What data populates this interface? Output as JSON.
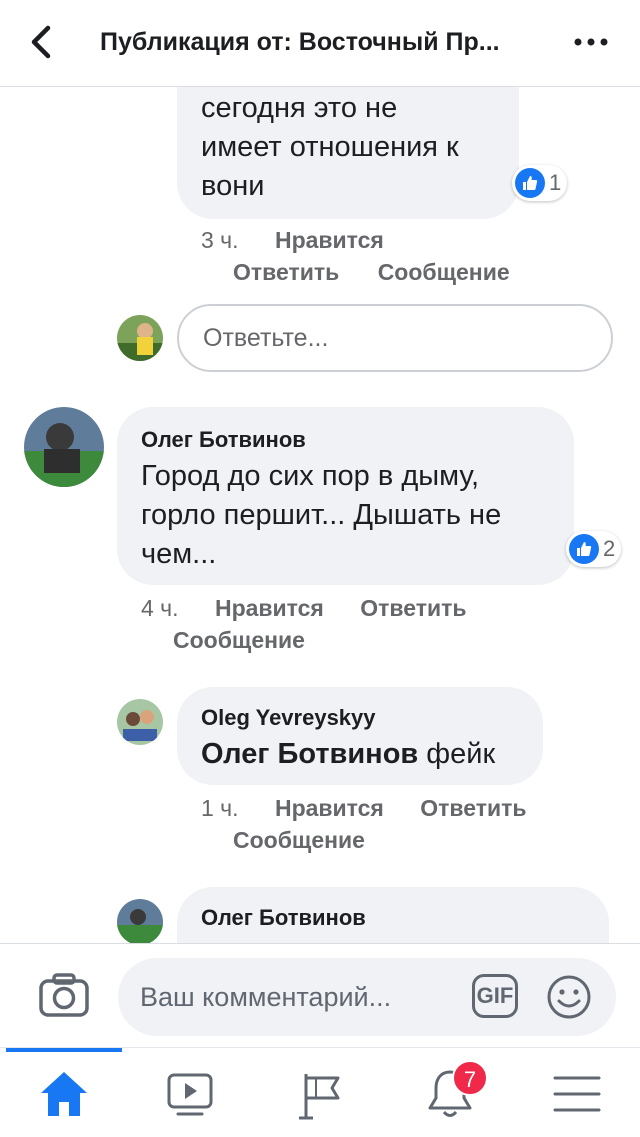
{
  "header": {
    "title": "Публикация от: Восточный Пр..."
  },
  "comments": [
    {
      "lines": [
        "сегодня это не",
        "имеет отношения к",
        "вони"
      ],
      "likes": "1",
      "time": "3 ч.",
      "like_label": "Нравится",
      "reply_label": "Ответить",
      "message_label": "Сообщение"
    },
    {
      "author": "Олег Ботвинов",
      "lines": [
        "Город до сих пор в дыму,",
        "горло першит... Дышать не",
        "чем..."
      ],
      "likes": "2",
      "time": "4 ч.",
      "like_label": "Нравится",
      "reply_label": "Ответить",
      "message_label": "Сообщение"
    },
    {
      "author": "Oleg Yevreyskyy",
      "mention": "Олег Ботвинов",
      "text": "фейк",
      "time": "1 ч.",
      "like_label": "Нравится",
      "reply_label": "Ответить",
      "message_label": "Сообщение"
    },
    {
      "author": "Олег Ботвинов"
    }
  ],
  "reply_box": {
    "placeholder": "Ответьте..."
  },
  "composer": {
    "placeholder": "Ваш комментарий...",
    "gif_label": "GIF"
  },
  "tabbar": {
    "tabs": [
      "home-icon",
      "video-icon",
      "pages-icon",
      "notifications-icon",
      "menu-icon"
    ],
    "notifications_count": "7",
    "active_color": "#1877f2",
    "badge_color": "#f02849"
  }
}
